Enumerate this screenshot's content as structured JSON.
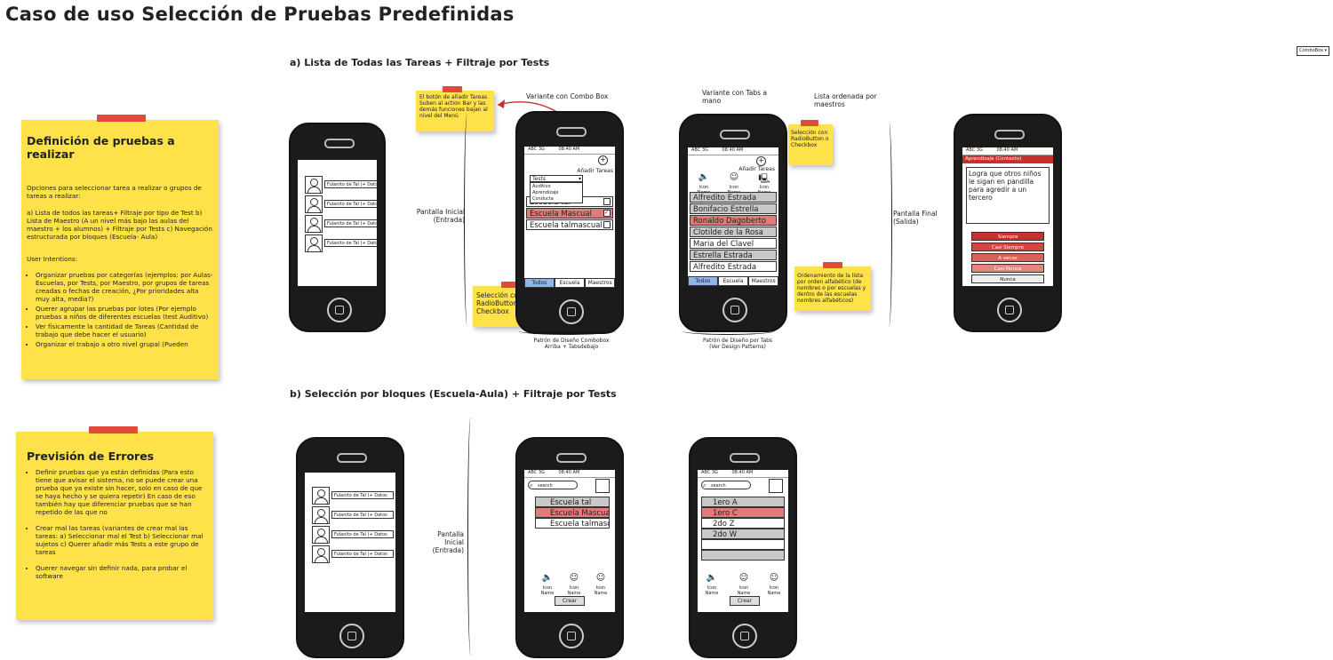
{
  "title": "Caso de uso Selección de Pruebas Predefinidas",
  "combobox_widget": "ComboBox",
  "section_a": "a) Lista de Todas las Tareas + Filtraje por Tests",
  "section_b": "b) Selección por bloques (Escuela-Aula) + Filtraje por Tests",
  "sticky1": {
    "heading": "Definición de pruebas a realizar",
    "intro": "Opciones para seleccionar tarea a realizar o grupos de tareas a realizar:",
    "options": "a) Lista de todos las tareas+ Filtraje por tipo de Test b) Lista de Maestro (A un nivel más bajo las aulas del maestro + los alumnos) + Filtraje por Tests c) Navegación estructurada por bloques (Escuela- Aula)",
    "intentions_label": "User Intentions:",
    "intentions": [
      "Organizar pruebas por categorías (ejemplos: por Aulas-Escuelas, por Tests, por Maestro, por grupos de tareas creadas o fechas de creación, ¿Por prioridades alta muy alta, media?)",
      "Querer agrupar las pruebas por lotes (Por ejemplo pruebas a niños de diferentes escuelas (test Auditivo)",
      "Ver físicamente la cantidad de Tareas (Cantidad de trabajo que debe hacer el usuario)",
      "Organizar el trabajo a otro nivel grupal (Pueden"
    ]
  },
  "sticky2": {
    "heading": "Previsión de Errores",
    "items": [
      "Definir pruebas que ya están definidas (Para esto tiene que avisar el sistema, no se puede crear una prueba que ya existe sin hacer, solo en caso de que se haya hecho y se quiera repetir) En caso de eso también hay que diferenciar pruebas que se han repetido de las que no",
      "Crear mal las tareas (variantes de crear mal las tareas: a) Seleccionar mal el Test b) Seleccionar mal sujetos c) Querer añadir más Tests a este grupo de tareas",
      "Querer navegar sin definir nada, para probar el software"
    ]
  },
  "note_add_task": "El botón de añadir Tareas Suben al action Bar y las demás funciones bajan al nivel del Menú",
  "note_radio": "Selección con RadioButton o Checkbox",
  "note_radio_small": "Selección con RadioButton o Checkbox",
  "note_order": "Ordenamiento de la lista por orden alfabético (de nombres o por escuelas y dentro de las escuelas nombres alfabéticos)",
  "labels": {
    "variante_combo": "Variante con Combo Box",
    "variante_tabs": "Variante con Tabs a mano",
    "lista_ordenada": "Lista ordenada por maestros",
    "pantalla_inicial_a": "Pantalla Inicial (Entrada)",
    "pantalla_final": "Pantalla Final (Salida)",
    "pantalla_inicial_b": "Pantalla Inicial (Entrada)",
    "patron_combo": "Patrón de Diseño Combobox Arriba + Tabsdebajo",
    "patron_tabs": "Patrón de Diseño por Tabs (Ver Design Patterns)"
  },
  "status_bar": {
    "signal": "ABC 3G",
    "time": "08:40 AM"
  },
  "phone1": {
    "items": [
      "Fulanito de Tal (+ Datos",
      "Fulanito de Tal (+ Datos",
      "Fulanito de Tal (+ Datos",
      "Fulanito de Tal (+ Datos"
    ]
  },
  "phone2": {
    "add_label": "Añadir Tareas",
    "combo_value": "Tests",
    "combo_options": [
      "Auditivo",
      "Aprendizaje",
      "Conducta"
    ],
    "rows": [
      "Escuela tal",
      "Escuela Mascual",
      "Escuela talmascual"
    ],
    "tabs": [
      "Todos",
      "Escuela",
      "Maestros"
    ]
  },
  "phone3": {
    "add_label": "Añadir Tareas",
    "icon_label": "Icon Name",
    "rows": [
      "Alfredito Estrada",
      "Bonifacio Estrella",
      "Ronaldo Dagoberto",
      "Clotilde de la Rosa",
      "Maria del Clavel",
      "Estrella Estrada",
      "Alfredito Estrada"
    ],
    "tabs": [
      "Todos",
      "Escuela",
      "Maestros"
    ]
  },
  "phone4": {
    "header": "Aprendizaje (Contexto)",
    "text": "Logra que otros niños le sigan en pandilla para agredir a un tercero",
    "buttons": [
      "Siempre",
      "Casi Siempre",
      "A veces",
      "Casi Nunca",
      "Nunca"
    ]
  },
  "phone5": {
    "items": [
      "Fulanito de Tal (+ Datos",
      "Fulanito de Tal (+ Datos",
      "Fulanito de Tal (+ Datos",
      "Fulanito de Tal (+ Datos"
    ]
  },
  "phone6": {
    "search": "search",
    "rows": [
      "Escuela tal",
      "Escuela Mascual",
      "Escuela talmascual"
    ],
    "icon_label": "Icon Name",
    "button": "Crear"
  },
  "phone7": {
    "search": "search",
    "rows": [
      "1ero A",
      "1ero C",
      "2do Z",
      "2do W"
    ],
    "icon_label": "Icon Name",
    "button": "Crear"
  }
}
